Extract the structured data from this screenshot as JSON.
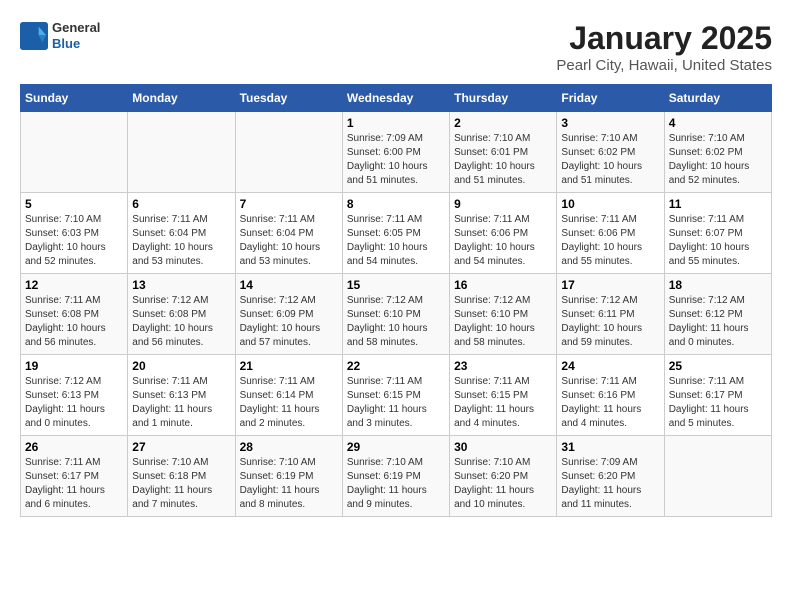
{
  "header": {
    "logo": {
      "line1": "General",
      "line2": "Blue"
    },
    "title": "January 2025",
    "subtitle": "Pearl City, Hawaii, United States"
  },
  "weekdays": [
    "Sunday",
    "Monday",
    "Tuesday",
    "Wednesday",
    "Thursday",
    "Friday",
    "Saturday"
  ],
  "weeks": [
    {
      "days": [
        {
          "num": "",
          "info": ""
        },
        {
          "num": "",
          "info": ""
        },
        {
          "num": "",
          "info": ""
        },
        {
          "num": "1",
          "info": "Sunrise: 7:09 AM\nSunset: 6:00 PM\nDaylight: 10 hours\nand 51 minutes."
        },
        {
          "num": "2",
          "info": "Sunrise: 7:10 AM\nSunset: 6:01 PM\nDaylight: 10 hours\nand 51 minutes."
        },
        {
          "num": "3",
          "info": "Sunrise: 7:10 AM\nSunset: 6:02 PM\nDaylight: 10 hours\nand 51 minutes."
        },
        {
          "num": "4",
          "info": "Sunrise: 7:10 AM\nSunset: 6:02 PM\nDaylight: 10 hours\nand 52 minutes."
        }
      ]
    },
    {
      "days": [
        {
          "num": "5",
          "info": "Sunrise: 7:10 AM\nSunset: 6:03 PM\nDaylight: 10 hours\nand 52 minutes."
        },
        {
          "num": "6",
          "info": "Sunrise: 7:11 AM\nSunset: 6:04 PM\nDaylight: 10 hours\nand 53 minutes."
        },
        {
          "num": "7",
          "info": "Sunrise: 7:11 AM\nSunset: 6:04 PM\nDaylight: 10 hours\nand 53 minutes."
        },
        {
          "num": "8",
          "info": "Sunrise: 7:11 AM\nSunset: 6:05 PM\nDaylight: 10 hours\nand 54 minutes."
        },
        {
          "num": "9",
          "info": "Sunrise: 7:11 AM\nSunset: 6:06 PM\nDaylight: 10 hours\nand 54 minutes."
        },
        {
          "num": "10",
          "info": "Sunrise: 7:11 AM\nSunset: 6:06 PM\nDaylight: 10 hours\nand 55 minutes."
        },
        {
          "num": "11",
          "info": "Sunrise: 7:11 AM\nSunset: 6:07 PM\nDaylight: 10 hours\nand 55 minutes."
        }
      ]
    },
    {
      "days": [
        {
          "num": "12",
          "info": "Sunrise: 7:11 AM\nSunset: 6:08 PM\nDaylight: 10 hours\nand 56 minutes."
        },
        {
          "num": "13",
          "info": "Sunrise: 7:12 AM\nSunset: 6:08 PM\nDaylight: 10 hours\nand 56 minutes."
        },
        {
          "num": "14",
          "info": "Sunrise: 7:12 AM\nSunset: 6:09 PM\nDaylight: 10 hours\nand 57 minutes."
        },
        {
          "num": "15",
          "info": "Sunrise: 7:12 AM\nSunset: 6:10 PM\nDaylight: 10 hours\nand 58 minutes."
        },
        {
          "num": "16",
          "info": "Sunrise: 7:12 AM\nSunset: 6:10 PM\nDaylight: 10 hours\nand 58 minutes."
        },
        {
          "num": "17",
          "info": "Sunrise: 7:12 AM\nSunset: 6:11 PM\nDaylight: 10 hours\nand 59 minutes."
        },
        {
          "num": "18",
          "info": "Sunrise: 7:12 AM\nSunset: 6:12 PM\nDaylight: 11 hours\nand 0 minutes."
        }
      ]
    },
    {
      "days": [
        {
          "num": "19",
          "info": "Sunrise: 7:12 AM\nSunset: 6:13 PM\nDaylight: 11 hours\nand 0 minutes."
        },
        {
          "num": "20",
          "info": "Sunrise: 7:11 AM\nSunset: 6:13 PM\nDaylight: 11 hours\nand 1 minute."
        },
        {
          "num": "21",
          "info": "Sunrise: 7:11 AM\nSunset: 6:14 PM\nDaylight: 11 hours\nand 2 minutes."
        },
        {
          "num": "22",
          "info": "Sunrise: 7:11 AM\nSunset: 6:15 PM\nDaylight: 11 hours\nand 3 minutes."
        },
        {
          "num": "23",
          "info": "Sunrise: 7:11 AM\nSunset: 6:15 PM\nDaylight: 11 hours\nand 4 minutes."
        },
        {
          "num": "24",
          "info": "Sunrise: 7:11 AM\nSunset: 6:16 PM\nDaylight: 11 hours\nand 4 minutes."
        },
        {
          "num": "25",
          "info": "Sunrise: 7:11 AM\nSunset: 6:17 PM\nDaylight: 11 hours\nand 5 minutes."
        }
      ]
    },
    {
      "days": [
        {
          "num": "26",
          "info": "Sunrise: 7:11 AM\nSunset: 6:17 PM\nDaylight: 11 hours\nand 6 minutes."
        },
        {
          "num": "27",
          "info": "Sunrise: 7:10 AM\nSunset: 6:18 PM\nDaylight: 11 hours\nand 7 minutes."
        },
        {
          "num": "28",
          "info": "Sunrise: 7:10 AM\nSunset: 6:19 PM\nDaylight: 11 hours\nand 8 minutes."
        },
        {
          "num": "29",
          "info": "Sunrise: 7:10 AM\nSunset: 6:19 PM\nDaylight: 11 hours\nand 9 minutes."
        },
        {
          "num": "30",
          "info": "Sunrise: 7:10 AM\nSunset: 6:20 PM\nDaylight: 11 hours\nand 10 minutes."
        },
        {
          "num": "31",
          "info": "Sunrise: 7:09 AM\nSunset: 6:20 PM\nDaylight: 11 hours\nand 11 minutes."
        },
        {
          "num": "",
          "info": ""
        }
      ]
    }
  ]
}
